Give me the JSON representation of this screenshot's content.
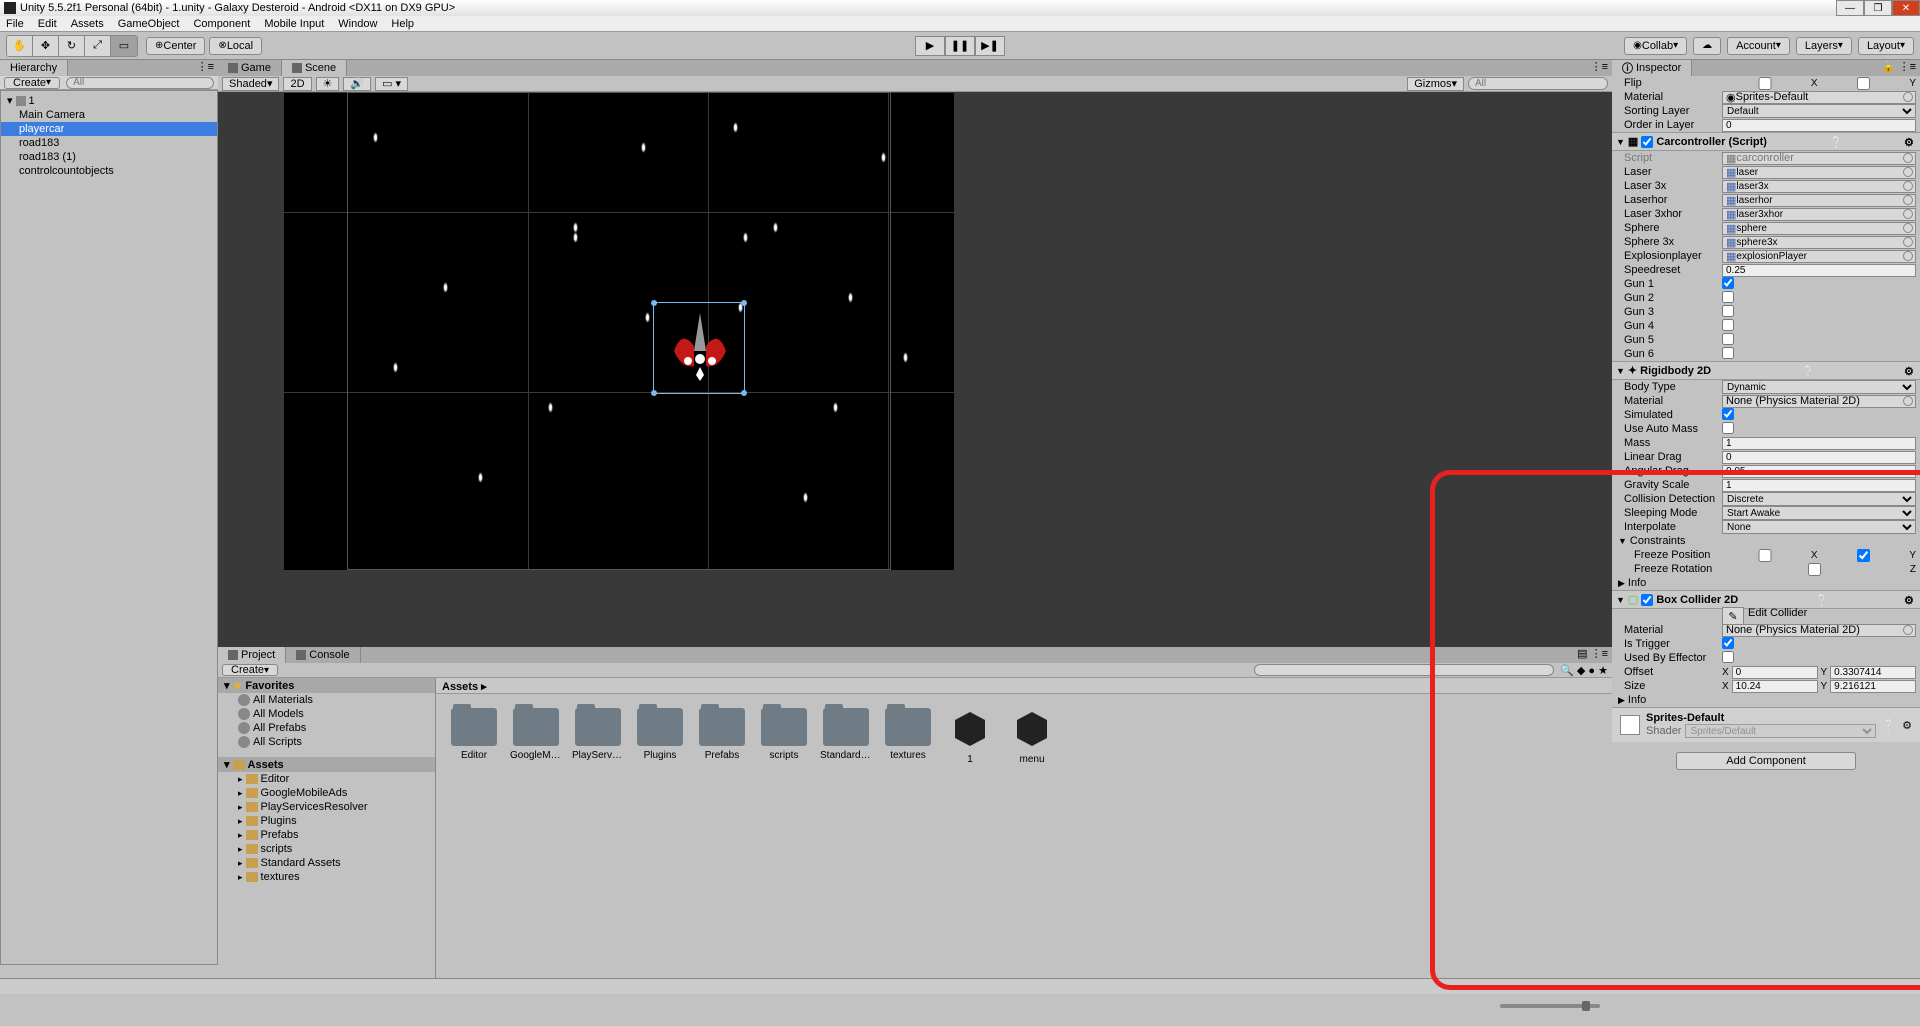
{
  "title": "Unity 5.5.2f1 Personal (64bit) - 1.unity - Galaxy Desteroid - Android <DX11 on DX9 GPU>",
  "menu": [
    "File",
    "Edit",
    "Assets",
    "GameObject",
    "Component",
    "Mobile Input",
    "Window",
    "Help"
  ],
  "toolbar": {
    "center": "Center",
    "local": "Local",
    "collab": "Collab",
    "account": "Account",
    "layers": "Layers",
    "layout": "Layout"
  },
  "hierarchy": {
    "tab": "Hierarchy",
    "create": "Create",
    "search": "All",
    "scene": "1",
    "items": [
      "Main Camera",
      "playercar",
      "road183",
      "road183 (1)",
      "controlcountobjects"
    ]
  },
  "scene": {
    "gameTab": "Game",
    "sceneTab": "Scene",
    "shaded": "Shaded",
    "mode2d": "2D",
    "gizmos": "Gizmos",
    "search": "All"
  },
  "project": {
    "tab": "Project",
    "consoleTab": "Console",
    "create": "Create",
    "favorites": "Favorites",
    "favItems": [
      "All Materials",
      "All Models",
      "All Prefabs",
      "All Scripts"
    ],
    "assetsHdr": "Assets",
    "tree": [
      "Editor",
      "GoogleMobileAds",
      "PlayServicesResolver",
      "Plugins",
      "Prefabs",
      "scripts",
      "Standard Assets",
      "textures"
    ],
    "breadcrumb": "Assets ▸",
    "gridItems": [
      "Editor",
      "GoogleMobi...",
      "PlayServic...",
      "Plugins",
      "Prefabs",
      "scripts",
      "Standard A...",
      "textures",
      "1",
      "menu"
    ]
  },
  "inspector": {
    "tab": "Inspector",
    "flip": "Flip",
    "material": "Material",
    "materialVal": "Sprites-Default",
    "sortingLayer": "Sorting Layer",
    "sortingLayerVal": "Default",
    "orderInLayer": "Order in Layer",
    "orderInLayerVal": "0",
    "carcontroller": {
      "title": "Carcontroller (Script)",
      "script": "Script",
      "scriptVal": "carconroller",
      "fields": [
        {
          "lbl": "Laser",
          "val": "laser",
          "type": "obj"
        },
        {
          "lbl": "Laser 3x",
          "val": "laser3x",
          "type": "obj"
        },
        {
          "lbl": "Laserhor",
          "val": "laserhor",
          "type": "obj"
        },
        {
          "lbl": "Laser 3xhor",
          "val": "laser3xhor",
          "type": "obj"
        },
        {
          "lbl": "Sphere",
          "val": "sphere",
          "type": "obj"
        },
        {
          "lbl": "Sphere 3x",
          "val": "sphere3x",
          "type": "obj"
        },
        {
          "lbl": "Explosionplayer",
          "val": "explosionPlayer",
          "type": "obj"
        },
        {
          "lbl": "Speedreset",
          "val": "0.25",
          "type": "text"
        },
        {
          "lbl": "Gun 1",
          "val": true,
          "type": "cb"
        },
        {
          "lbl": "Gun 2",
          "val": false,
          "type": "cb"
        },
        {
          "lbl": "Gun 3",
          "val": false,
          "type": "cb"
        },
        {
          "lbl": "Gun 4",
          "val": false,
          "type": "cb"
        },
        {
          "lbl": "Gun 5",
          "val": false,
          "type": "cb"
        },
        {
          "lbl": "Gun 6",
          "val": false,
          "type": "cb"
        }
      ]
    },
    "rigidbody": {
      "title": "Rigidbody 2D",
      "bodyType": "Body Type",
      "bodyTypeVal": "Dynamic",
      "material": "Material",
      "materialVal": "None (Physics Material 2D)",
      "simulated": "Simulated",
      "useAutoMass": "Use Auto Mass",
      "mass": "Mass",
      "massVal": "1",
      "linearDrag": "Linear Drag",
      "linearDragVal": "0",
      "angularDrag": "Angular Drag",
      "angularDragVal": "0.05",
      "gravityScale": "Gravity Scale",
      "gravityScaleVal": "1",
      "collisionDetection": "Collision Detection",
      "collisionDetectionVal": "Discrete",
      "sleepingMode": "Sleeping Mode",
      "sleepingModeVal": "Start Awake",
      "interpolate": "Interpolate",
      "interpolateVal": "None",
      "constraints": "Constraints",
      "freezePos": "Freeze Position",
      "freezeRot": "Freeze Rotation",
      "info": "Info"
    },
    "boxcollider": {
      "title": "Box Collider 2D",
      "editCollider": "Edit Collider",
      "material": "Material",
      "materialVal": "None (Physics Material 2D)",
      "isTrigger": "Is Trigger",
      "usedByEffector": "Used By Effector",
      "offset": "Offset",
      "offsetX": "0",
      "offsetY": "0.3307414",
      "size": "Size",
      "sizeX": "10.24",
      "sizeY": "9.216121",
      "info": "Info"
    },
    "spriteMat": "Sprites-Default",
    "shader": "Shader",
    "shaderVal": "Sprites/Default",
    "addComponent": "Add Component"
  }
}
